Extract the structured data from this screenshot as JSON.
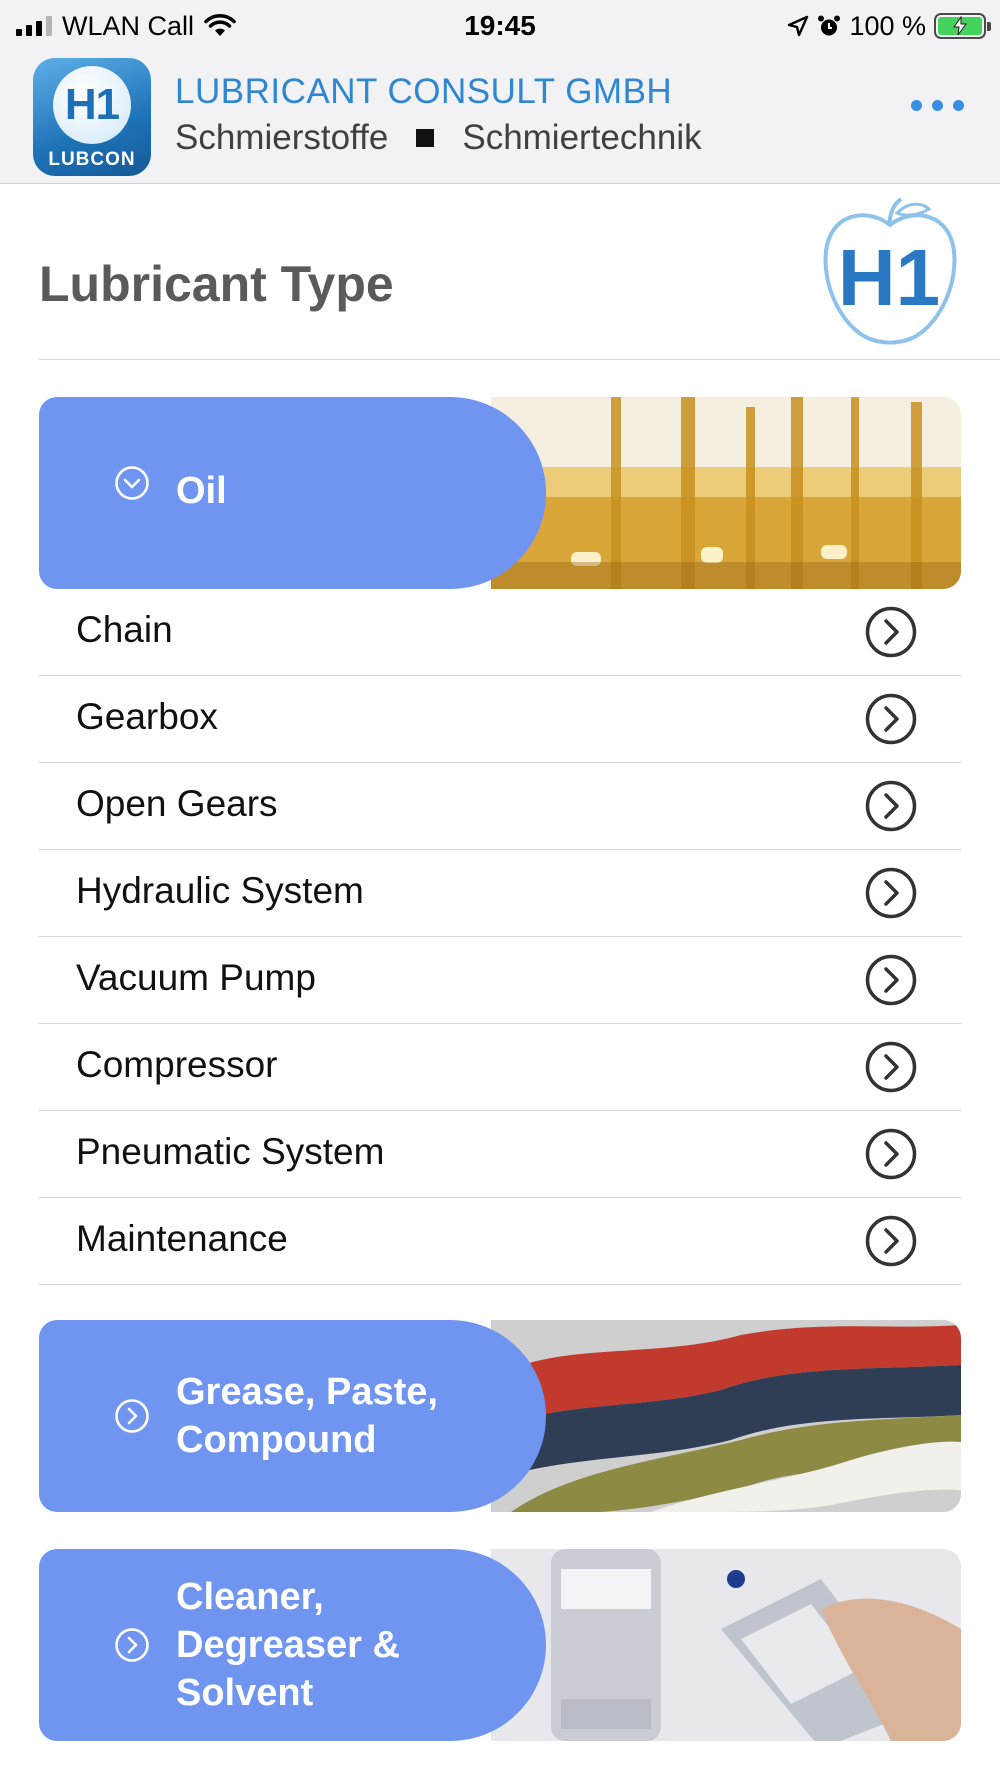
{
  "status_bar": {
    "carrier": "WLAN Call",
    "time": "19:45",
    "battery_percent": "100 %",
    "battery_level": 1.0,
    "icons": [
      "signal-icon",
      "wifi-icon",
      "location-arrow-icon",
      "alarm-icon",
      "battery-charging-icon"
    ]
  },
  "header": {
    "logo_mark": "H1",
    "logo_text": "LUBCON",
    "company_name": "LUBRICANT CONSULT GMBH",
    "subtitle_left": "Schmierstoffe",
    "subtitle_right": "Schmiertechnik",
    "menu_icon": "more-dots-icon"
  },
  "page": {
    "title": "Lubricant Type",
    "badge": "H1"
  },
  "categories": [
    {
      "label": "Oil",
      "state": "expanded",
      "icon": "chevron-down-circle-icon",
      "items": [
        "Chain",
        "Gearbox",
        "Open Gears",
        "Hydraulic System",
        "Vacuum Pump",
        "Compressor",
        "Pneumatic System",
        "Maintenance"
      ]
    },
    {
      "label_line1": "Grease, Paste,",
      "label_line2": "Compound",
      "state": "collapsed",
      "icon": "chevron-right-circle-icon"
    },
    {
      "label_line1": "Cleaner,",
      "label_line2": "Degreaser &",
      "label_line3": "Solvent",
      "state": "collapsed",
      "icon": "chevron-right-circle-icon"
    }
  ],
  "colors": {
    "accent": "#7095f0",
    "brand_blue": "#2f86d2",
    "header_bg": "#f2f2f4",
    "menu_dots": "#3a8fe2"
  }
}
